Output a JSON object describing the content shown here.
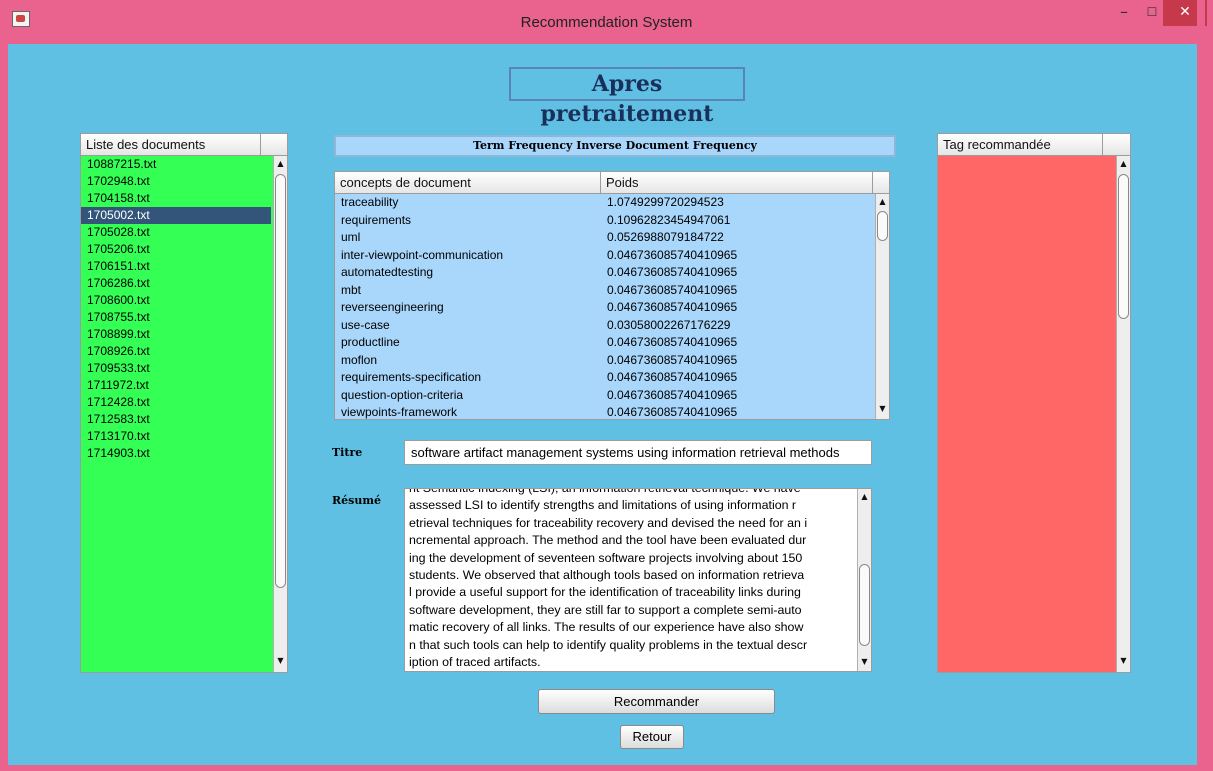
{
  "window": {
    "title": "Recommendation System"
  },
  "heading": "Apres pretraitement",
  "documents": {
    "header": "Liste des documents",
    "items": [
      "10887215.txt",
      "1702948.txt",
      "1704158.txt",
      "1705002.txt",
      "1705028.txt",
      "1705206.txt",
      "1706151.txt",
      "1706286.txt",
      "1708600.txt",
      "1708755.txt",
      "1708899.txt",
      "1708926.txt",
      "1709533.txt",
      "1711972.txt",
      "1712428.txt",
      "1712583.txt",
      "1713170.txt",
      "1714903.txt"
    ],
    "selected": "1705002.txt"
  },
  "tfidf": {
    "title": "Term Frequency Inverse Document Frequency",
    "columns": [
      "concepts de document",
      "Poids"
    ],
    "rows": [
      [
        "traceability",
        "1.0749299720294523"
      ],
      [
        "requirements",
        "0.10962823454947061"
      ],
      [
        "uml",
        "0.0526988079184722"
      ],
      [
        "inter-viewpoint-communication",
        "0.046736085740410965"
      ],
      [
        "automatedtesting",
        "0.046736085740410965"
      ],
      [
        "mbt",
        "0.046736085740410965"
      ],
      [
        "reverseengineering",
        "0.046736085740410965"
      ],
      [
        "use-case",
        "0.03058002267176229"
      ],
      [
        "productline",
        "0.046736085740410965"
      ],
      [
        "moflon",
        "0.046736085740410965"
      ],
      [
        "requirements-specification",
        "0.046736085740410965"
      ],
      [
        "question-option-criteria",
        "0.046736085740410965"
      ],
      [
        "viewpoints-framework",
        "0.046736085740410965"
      ]
    ]
  },
  "titre": {
    "label": "Titre",
    "value": "software artifact management systems using information retrieval methods"
  },
  "resume": {
    "label": "Résumé",
    "lines": [
      "nt Semantic Indexing (LSI), an information retrieval technique. We have",
      "assessed LSI to identify strengths and limitations of using information r",
      "etrieval techniques for traceability recovery and devised the need for an i",
      "ncremental approach. The method and the tool have been evaluated dur",
      "ing the development of seventeen software projects involving about 150",
      "students. We observed that although tools based on information retrieva",
      "l provide a useful support for the identification of traceability links during",
      "software development, they are still far to support a complete semi-auto",
      "matic recovery of all links. The results of our experience have also show",
      "n that such tools can help to identify quality problems in the textual descr",
      "iption of traced artifacts."
    ]
  },
  "tags": {
    "header": "Tag recommandée"
  },
  "buttons": {
    "recommander": "Recommander",
    "retour": "Retour"
  },
  "icons": {
    "scroll_up": "▲",
    "scroll_down": "▼",
    "minimize": "–",
    "maximize": "☐",
    "close": "✕"
  },
  "colors": {
    "title_bar": "#e9638e",
    "background": "#5fc0e4",
    "doc_list": "#33ff55",
    "tfidf_table": "#a9d6fb",
    "tag_list": "#ff6666",
    "selection": "#33557a"
  }
}
